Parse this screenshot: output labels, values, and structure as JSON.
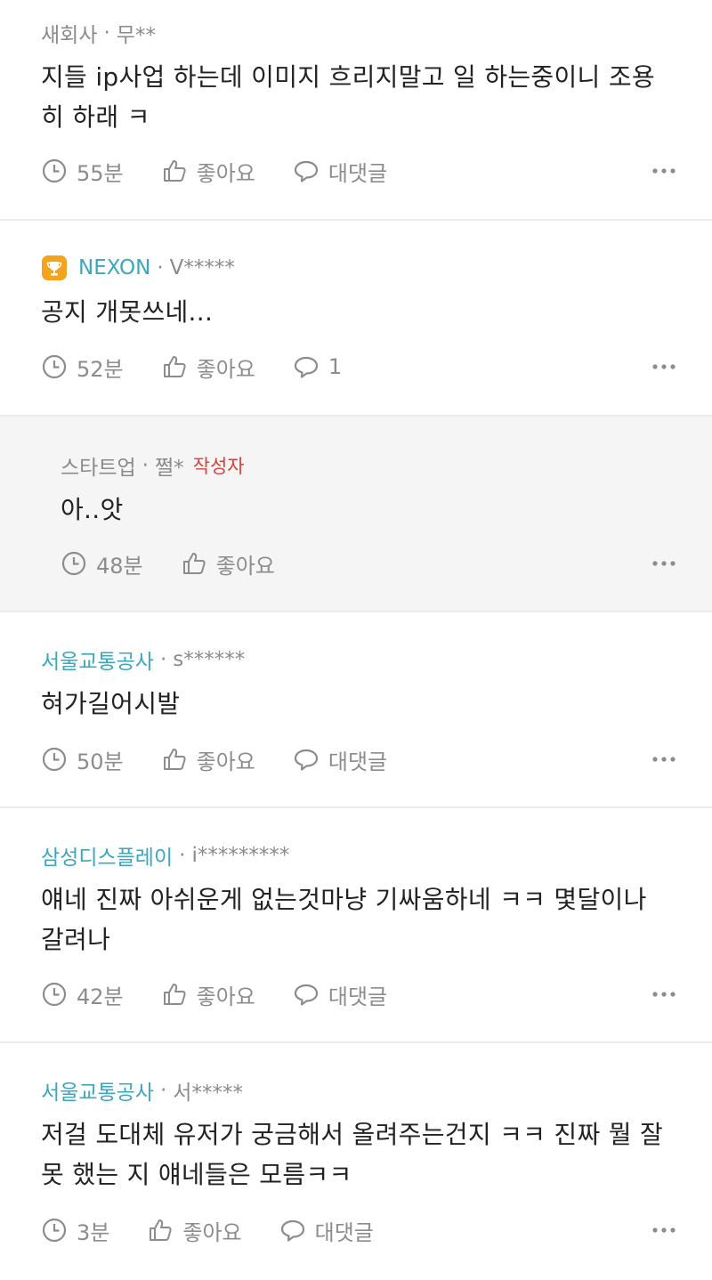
{
  "comments": [
    {
      "company": "새회사",
      "user": "무**",
      "text": "지들 ip사업 하는데 이미지 흐리지말고 일 하는중이니 조용히 하래 ㅋ",
      "time": "55분",
      "like_label": "좋아요",
      "reply_label": "대댓글"
    },
    {
      "company": "NEXON",
      "user": "V*****",
      "text": "공지 개못쓰네...",
      "time": "52분",
      "like_label": "좋아요",
      "reply_label": "1"
    },
    {
      "company": "스타트업",
      "user": "쩔*",
      "author_badge": "작성자",
      "text": "아..앗",
      "time": "48분",
      "like_label": "좋아요"
    },
    {
      "company": "서울교통공사",
      "user": "s******",
      "text": "혀가길어시발",
      "time": "50분",
      "like_label": "좋아요",
      "reply_label": "대댓글"
    },
    {
      "company": "삼성디스플레이",
      "user": "i*********",
      "text": "얘네 진짜 아쉬운게 없는것마냥 기싸움하네 ㅋㅋ 몇달이나 갈려나",
      "time": "42분",
      "like_label": "좋아요",
      "reply_label": "대댓글"
    },
    {
      "company": "서울교통공사",
      "user": "서*****",
      "text": "저걸 도대체 유저가 궁금해서 올려주는건지 ㅋㅋ 진짜 뭘 잘 못 했는 지 얘네들은 모름ㅋㅋ",
      "time": "3분",
      "like_label": "좋아요",
      "reply_label": "대댓글"
    }
  ],
  "separator": "·",
  "colors": {
    "company_link": "#3ba7bf",
    "author_badge": "#d9443a",
    "muted": "#8a8a8a",
    "reply_bg": "#f5f5f5"
  },
  "icons": [
    "clock-icon",
    "thumbs-up-icon",
    "speech-bubble-icon",
    "more-dots-icon",
    "trophy-icon"
  ]
}
